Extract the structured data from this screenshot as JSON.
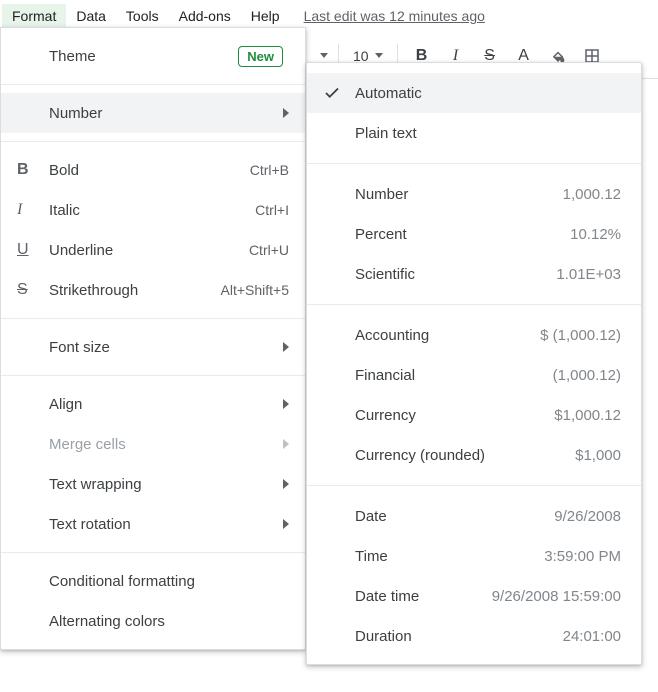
{
  "menubar": {
    "items": [
      "Format",
      "Data",
      "Tools",
      "Add-ons",
      "Help"
    ],
    "edit_status": "Last edit was 12 minutes ago"
  },
  "toolbar": {
    "font_size": "10"
  },
  "format_menu": {
    "theme": {
      "label": "Theme",
      "badge": "New"
    },
    "number": {
      "label": "Number"
    },
    "bold": {
      "label": "Bold",
      "shortcut": "Ctrl+B"
    },
    "italic": {
      "label": "Italic",
      "shortcut": "Ctrl+I"
    },
    "underline": {
      "label": "Underline",
      "shortcut": "Ctrl+U"
    },
    "strike": {
      "label": "Strikethrough",
      "shortcut": "Alt+Shift+5"
    },
    "font_size": {
      "label": "Font size"
    },
    "align": {
      "label": "Align"
    },
    "merge": {
      "label": "Merge cells"
    },
    "wrap": {
      "label": "Text wrapping"
    },
    "rotation": {
      "label": "Text rotation"
    },
    "cond": {
      "label": "Conditional formatting"
    },
    "alt": {
      "label": "Alternating colors"
    }
  },
  "number_menu": {
    "automatic": {
      "label": "Automatic"
    },
    "plain": {
      "label": "Plain text"
    },
    "number": {
      "label": "Number",
      "example": "1,000.12"
    },
    "percent": {
      "label": "Percent",
      "example": "10.12%"
    },
    "scientific": {
      "label": "Scientific",
      "example": "1.01E+03"
    },
    "accounting": {
      "label": "Accounting",
      "example": "$ (1,000.12)"
    },
    "financial": {
      "label": "Financial",
      "example": "(1,000.12)"
    },
    "currency": {
      "label": "Currency",
      "example": "$1,000.12"
    },
    "currency_r": {
      "label": "Currency (rounded)",
      "example": "$1,000"
    },
    "date": {
      "label": "Date",
      "example": "9/26/2008"
    },
    "time": {
      "label": "Time",
      "example": "3:59:00 PM"
    },
    "datetime": {
      "label": "Date time",
      "example": "9/26/2008 15:59:00"
    },
    "duration": {
      "label": "Duration",
      "example": "24:01:00"
    }
  }
}
